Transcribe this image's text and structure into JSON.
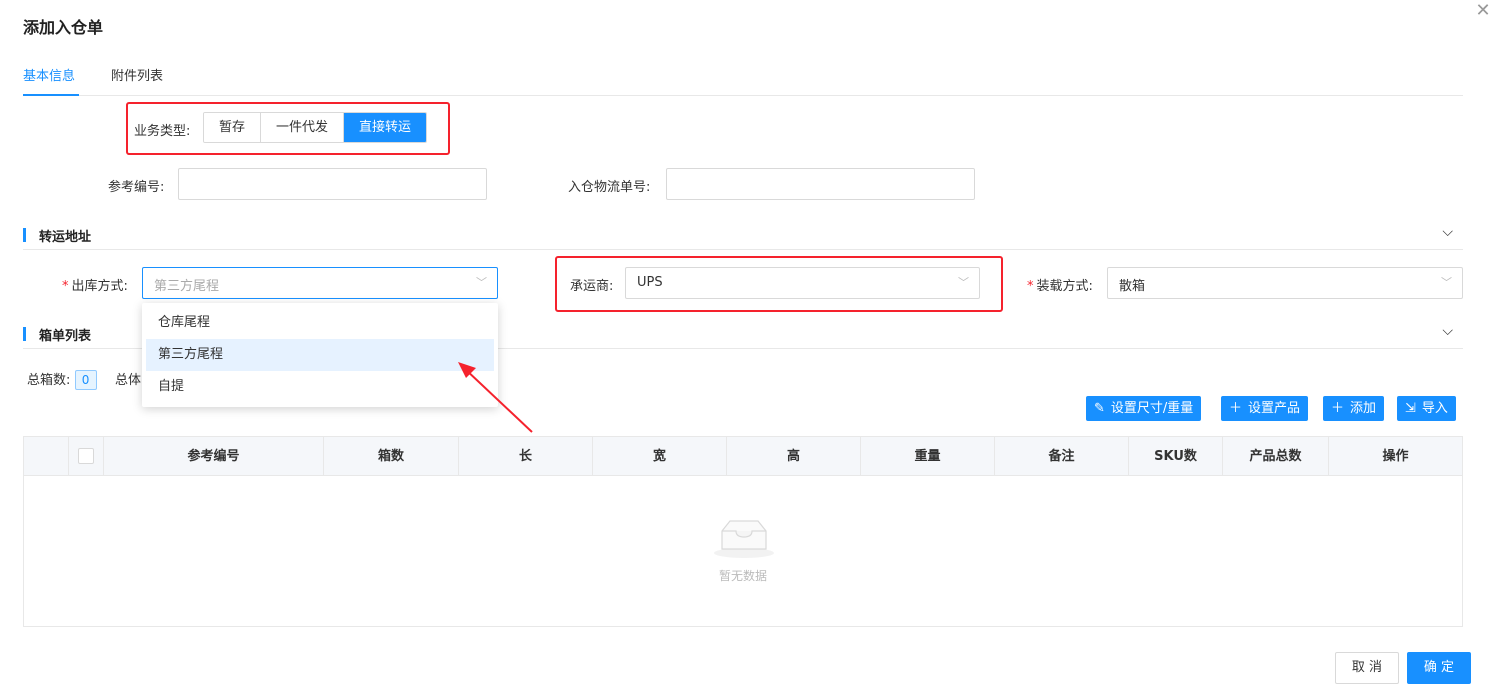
{
  "dialog": {
    "title": "添加入仓单",
    "close_icon": "close-icon"
  },
  "tabs": [
    {
      "label": "基本信息",
      "active": true
    },
    {
      "label": "附件列表",
      "active": false
    }
  ],
  "business_type": {
    "label": "业务类型:",
    "options": [
      "暂存",
      "一件代发",
      "直接转运"
    ],
    "selected": "直接转运"
  },
  "reference": {
    "ref_no_label": "参考编号:",
    "ref_no_value": "",
    "logistics_no_label": "入仓物流单号:",
    "logistics_no_value": ""
  },
  "transfer_section": {
    "title": "转运地址",
    "outbound_method": {
      "required_mark": "*",
      "label": "出库方式:",
      "placeholder": "第三方尾程"
    },
    "carrier": {
      "label": "承运商:",
      "value": "UPS"
    },
    "loading_method": {
      "required_mark": "*",
      "label": "装载方式:",
      "value": "散箱"
    }
  },
  "dropdown": {
    "options": [
      "仓库尾程",
      "第三方尾程",
      "自提"
    ],
    "hovered": "第三方尾程"
  },
  "box_section": {
    "title": "箱单列表",
    "total_boxes_label": "总箱数:",
    "total_boxes_value": "0",
    "total_volume_label": "总体",
    "actions": [
      {
        "label": "设置尺寸/重量",
        "icon": "edit-icon"
      },
      {
        "label": "设置产品",
        "icon": "plus-icon"
      },
      {
        "label": "添加",
        "icon": "plus-icon"
      },
      {
        "label": "导入",
        "icon": "import-icon"
      }
    ]
  },
  "table": {
    "columns": [
      "参考编号",
      "箱数",
      "长",
      "宽",
      "高",
      "重量",
      "备注",
      "SKU数",
      "产品总数",
      "操作"
    ],
    "rows": [],
    "empty_text": "暂无数据"
  },
  "footer": {
    "cancel_label": "取 消",
    "confirm_label": "确 定"
  },
  "colors": {
    "primary": "#1890ff",
    "highlight_border": "#f5222d",
    "required": "#f5222d"
  }
}
